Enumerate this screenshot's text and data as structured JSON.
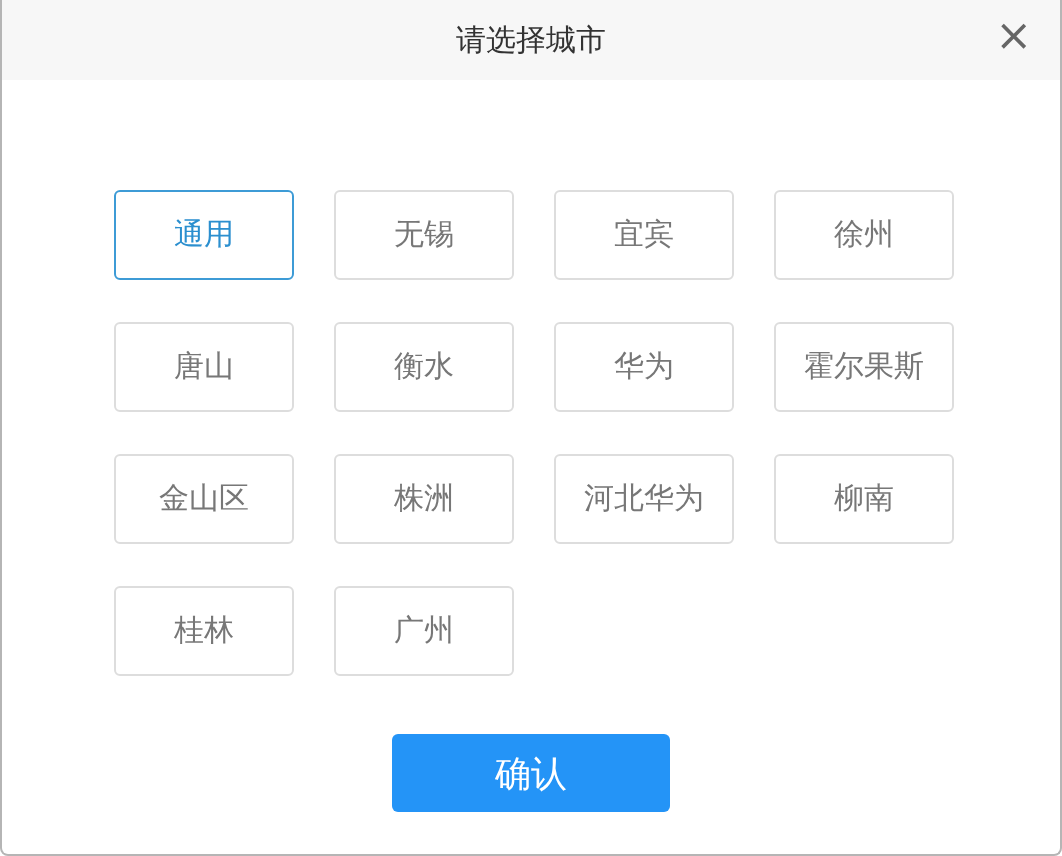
{
  "dialog": {
    "title": "请选择城市",
    "close": "×"
  },
  "cities": [
    {
      "label": "通用",
      "selected": true
    },
    {
      "label": "无锡",
      "selected": false
    },
    {
      "label": "宜宾",
      "selected": false
    },
    {
      "label": "徐州",
      "selected": false
    },
    {
      "label": "唐山",
      "selected": false
    },
    {
      "label": "衡水",
      "selected": false
    },
    {
      "label": "华为",
      "selected": false
    },
    {
      "label": "霍尔果斯",
      "selected": false
    },
    {
      "label": "金山区",
      "selected": false
    },
    {
      "label": "株洲",
      "selected": false
    },
    {
      "label": "河北华为",
      "selected": false
    },
    {
      "label": "柳南",
      "selected": false
    },
    {
      "label": "桂林",
      "selected": false
    },
    {
      "label": "广州",
      "selected": false
    }
  ],
  "confirm": "确认"
}
